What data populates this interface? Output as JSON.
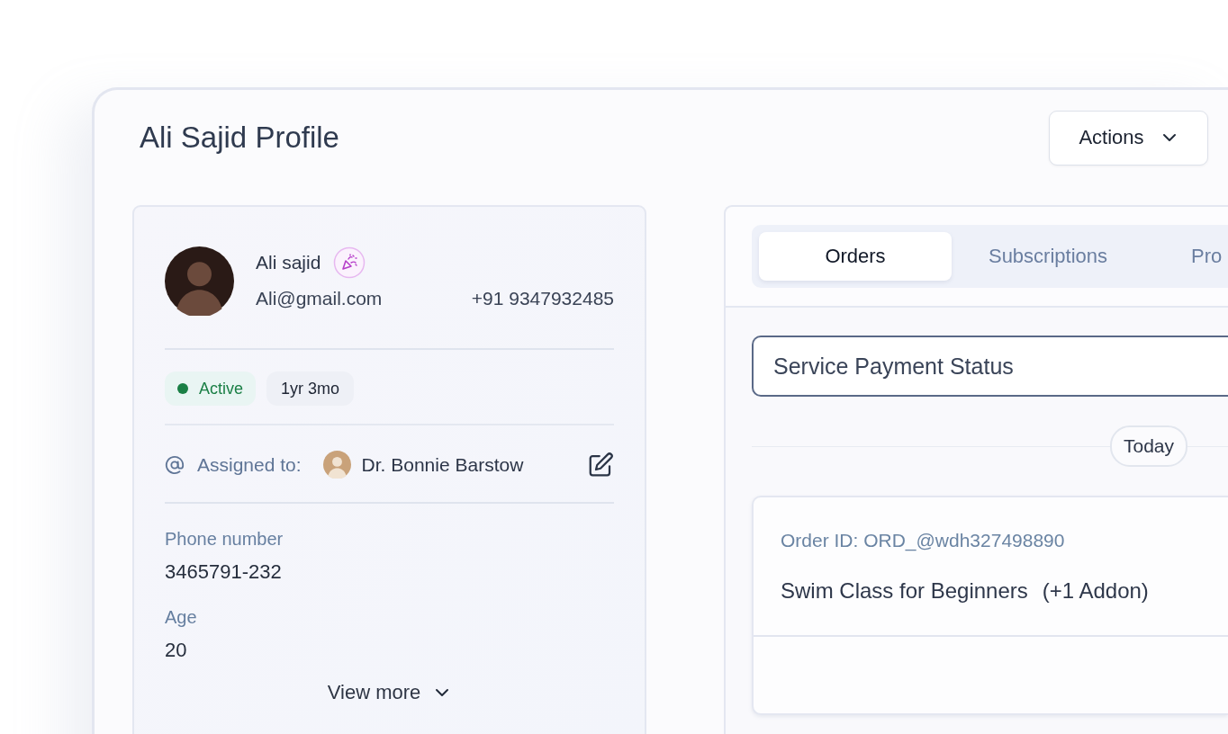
{
  "page": {
    "title": "Ali Sajid Profile",
    "actions_button": "Actions"
  },
  "profile": {
    "name": "Ali sajid",
    "email": "Ali@gmail.com",
    "phone": "+91 9347932485",
    "status": {
      "label": "Active",
      "color": "#1a7f45"
    },
    "tenure": "1yr 3mo",
    "assigned_label": "Assigned to:",
    "assigned_to": "Dr. Bonnie Barstow",
    "fields": [
      {
        "label": "Phone number",
        "value": "3465791-232"
      },
      {
        "label": "Age",
        "value": "20"
      }
    ],
    "view_more": "View more"
  },
  "tabs": [
    {
      "label": "Orders",
      "selected": true
    },
    {
      "label": "Subscriptions",
      "selected": false
    },
    {
      "label": "Pro",
      "selected": false
    }
  ],
  "filter": {
    "value": "Service Payment Status"
  },
  "date_divider": "Today",
  "orders": [
    {
      "order_id": "Order ID: ORD_@wdh327498890",
      "title": "Swim Class for Beginners",
      "addon": "(+1 Addon)"
    }
  ]
}
